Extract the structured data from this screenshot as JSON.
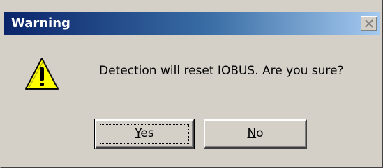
{
  "window": {
    "title": "Warning"
  },
  "message": {
    "text": "Detection will reset IOBUS. Are you sure?"
  },
  "buttons": {
    "yes": {
      "accel": "Y",
      "rest": "es"
    },
    "no": {
      "accel": "N",
      "rest": "o"
    }
  },
  "icons": {
    "close": "close-icon",
    "warning": "warning-icon"
  },
  "colors": {
    "titlebar_start": "#0a246a",
    "titlebar_end": "#a6caf0",
    "dialog_bg": "#d4d0c8",
    "warning_fill": "#ffff00"
  }
}
